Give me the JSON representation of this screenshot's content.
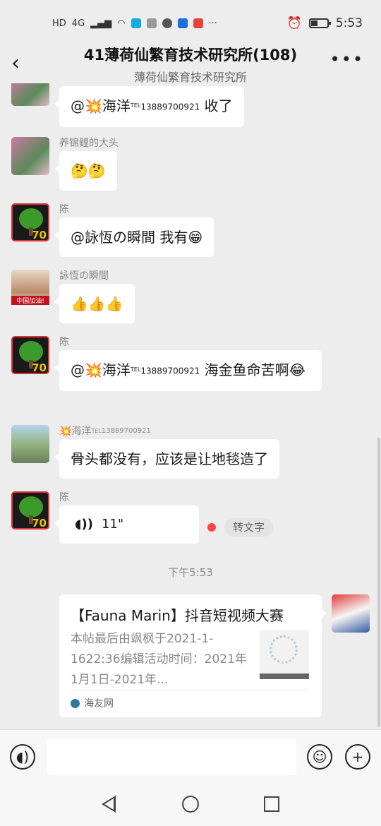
{
  "status_bar": {
    "left_badges": [
      "HD",
      "4G"
    ],
    "more": "···",
    "time": "5:53"
  },
  "header": {
    "title": "41薄荷仙繁育技术研究所(108)",
    "subtitle": "薄荷仙繁育技术研究所",
    "back_icon": "‹",
    "more_icon": "•••"
  },
  "messages": [
    {
      "sender": "",
      "text_prefix": "@💥海洋",
      "tel": "TEL",
      "phone": "13889700921",
      "text_suffix": " 收了"
    },
    {
      "sender": "养锦鲤的大头",
      "text": "🤔🤔"
    },
    {
      "sender": "陈",
      "text": "@詠恆の瞬間 我有😁"
    },
    {
      "sender": "詠恆の瞬間",
      "text": "👍👍👍",
      "avatar_tag": "中国加油!"
    },
    {
      "sender": "陈",
      "text_prefix": "@💥海洋",
      "tel": "TEL",
      "phone": "13889700921",
      "text_suffix": " 海金鱼命苦啊😂"
    },
    {
      "sender_prefix": "💥海洋",
      "sender_tel": "TEL",
      "sender_phone": "13889700921",
      "text": "骨头都没有，应该是让地毯造了"
    },
    {
      "sender": "陈",
      "voice_duration": "11\"",
      "voice_icon": "◖))",
      "convert_label": "转文字"
    }
  ],
  "tree_avatar_num": "70",
  "timestamp": "下午5:53",
  "card": {
    "title": "【Fauna Marin】抖音短视频大赛",
    "description": "本帖最后由飒枫于2021-1-1622:36编辑活动时间：2021年1月1日-2021年...",
    "source": "海友网"
  },
  "input_bar": {
    "voice_icon": "◖)",
    "emoji_icon": "☺",
    "plus_icon": "+",
    "placeholder": ""
  }
}
